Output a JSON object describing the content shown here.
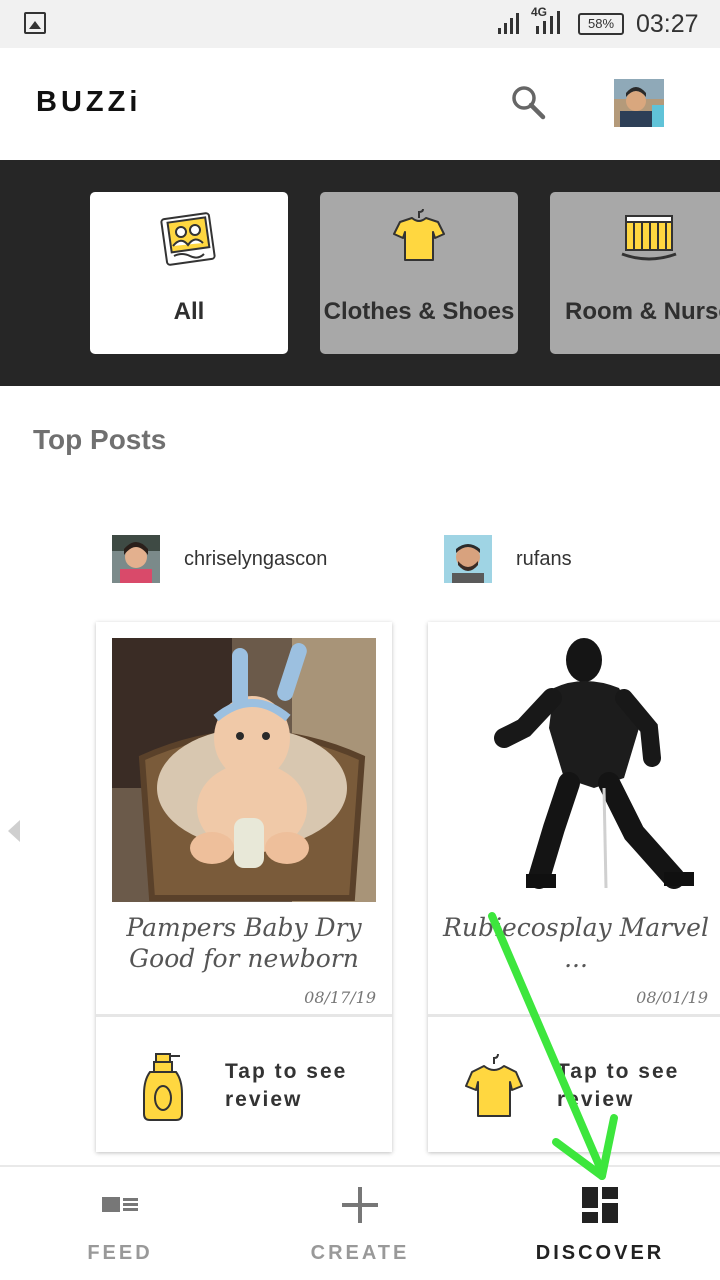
{
  "status_bar": {
    "network": "4G",
    "battery": "58%",
    "time": "03:27"
  },
  "header": {
    "logo": "BUZZi",
    "search_icon": "search-icon",
    "avatar": "profile-avatar"
  },
  "categories": [
    {
      "label": "All",
      "icon": "family-photo-icon",
      "selected": true
    },
    {
      "label": "Clothes & Shoes",
      "icon": "tshirt-icon",
      "selected": false
    },
    {
      "label": "Room & Nursery",
      "icon": "crib-icon",
      "selected": false
    }
  ],
  "section_title": "Top Posts",
  "posts": [
    {
      "username": "chriselyngascon",
      "title": "Pampers Baby Dry Good for newborn",
      "date": "08/17/19",
      "review_label": "Tap to see review",
      "review_icon": "lotion-bottle-icon"
    },
    {
      "username": "rufans",
      "title": "Rubiecosplay Marvel ...",
      "date": "08/01/19",
      "review_label": "Tap to see review",
      "review_icon": "tshirt-icon"
    }
  ],
  "bottom_nav": {
    "items": [
      {
        "label": "FEED",
        "icon": "feed-icon",
        "active": false
      },
      {
        "label": "CREATE",
        "icon": "plus-icon",
        "active": false
      },
      {
        "label": "DISCOVER",
        "icon": "grid-icon",
        "active": true
      }
    ]
  },
  "colors": {
    "accent_yellow": "#FFD740",
    "category_band": "#262626",
    "annotation_arrow": "#3DE63D"
  }
}
